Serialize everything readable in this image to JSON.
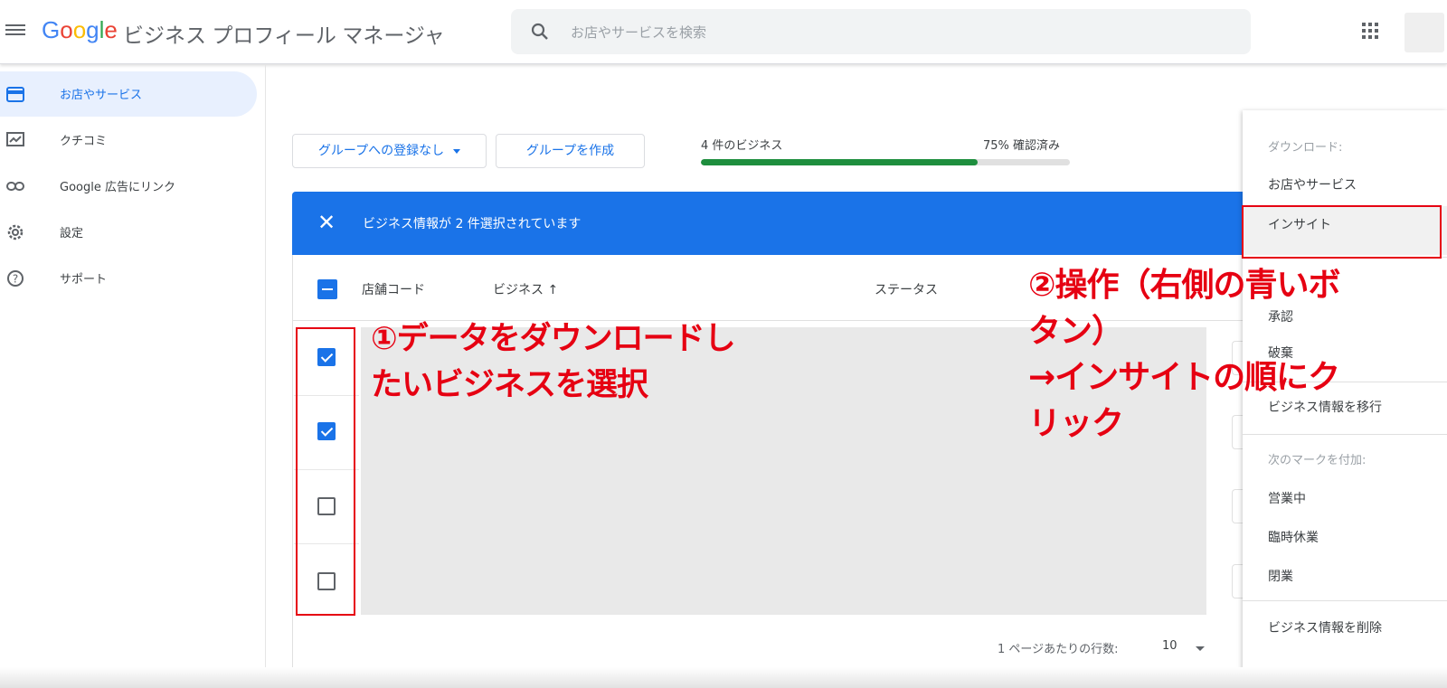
{
  "header": {
    "logo_letters": [
      "G",
      "o",
      "o",
      "g",
      "l",
      "e"
    ],
    "product": "ビジネス プロフィール マネージャ",
    "search_placeholder": "お店やサービスを検索"
  },
  "sidebar": {
    "items": [
      {
        "label": "お店やサービス",
        "icon": "store-icon",
        "active": true
      },
      {
        "label": "クチコミ",
        "icon": "review-icon",
        "active": false
      },
      {
        "label": "Google 広告にリンク",
        "icon": "link-icon",
        "active": false
      },
      {
        "label": "設定",
        "icon": "gear-icon",
        "active": false
      },
      {
        "label": "サポート",
        "icon": "help-icon",
        "active": false
      }
    ]
  },
  "toolbar": {
    "group_dropdown": "グループへの登録なし",
    "create_group": "グループを作成",
    "business_count": "4 件のビジネス",
    "verified": "75% 確認済み",
    "verified_progress": 0.75
  },
  "selection": {
    "message": "ビジネス情報が 2 件選択されています"
  },
  "table": {
    "columns": [
      "店舗コード",
      "ビジネス ↑",
      "ステータス"
    ],
    "rows": [
      {
        "checked": true
      },
      {
        "checked": true
      },
      {
        "checked": false
      },
      {
        "checked": false
      }
    ],
    "rows_per_page_label": "1 ページあたりの行数:",
    "rows_per_page": "10"
  },
  "menu": {
    "download_header": "ダウンロード:",
    "download_items": [
      "お店やサービス",
      "インサイト"
    ],
    "action_items": [
      "承認",
      "破棄"
    ],
    "transfer": "ビジネス情報を移行",
    "mark_header": "次のマークを付加:",
    "mark_items": [
      "営業中",
      "臨時休業",
      "閉業"
    ],
    "delete": "ビジネス情報を削除"
  },
  "annotations": {
    "step1": "①データをダウンロードし\nたいビジネスを選択",
    "step2": "②操作（右側の青いボ\nタン）\n→インサイトの順にク\nリック"
  },
  "colors": {
    "accent": "#1a73e8",
    "annotation": "#e60012",
    "progress": "#1e8e3e"
  }
}
